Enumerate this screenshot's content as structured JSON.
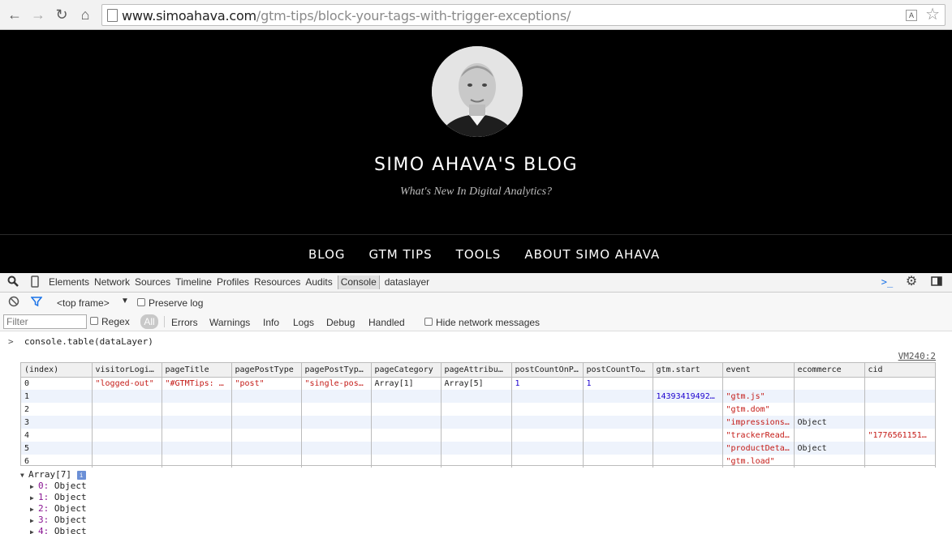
{
  "browser": {
    "url_host": "www.simoahava.com",
    "url_path": "/gtm-tips/block-your-tags-with-trigger-exceptions/"
  },
  "site": {
    "title": "SIMO AHAVA'S BLOG",
    "tagline": "What's New In Digital Analytics?",
    "nav": [
      "BLOG",
      "GTM TIPS",
      "TOOLS",
      "ABOUT SIMO AHAVA"
    ]
  },
  "devtools": {
    "tabs": [
      "Elements",
      "Network",
      "Sources",
      "Timeline",
      "Profiles",
      "Resources",
      "Audits",
      "Console",
      "dataslayer"
    ],
    "active_tab": "Console",
    "frame_select": "<top frame>",
    "preserve_log": "Preserve log",
    "filter_placeholder": "Filter",
    "regex_label": "Regex",
    "levels": [
      "All",
      "Errors",
      "Warnings",
      "Info",
      "Logs",
      "Debug",
      "Handled"
    ],
    "hide_network": "Hide network messages",
    "command": "console.table(dataLayer)",
    "source_link": "VM240:2",
    "table": {
      "headers": [
        "(index)",
        "visitorLogi…",
        "pageTitle",
        "pagePostType",
        "pagePostTyp…",
        "pageCategory",
        "pageAttribu…",
        "postCountOnP…",
        "postCountTo…",
        "gtm.start",
        "event",
        "ecommerce",
        "cid"
      ],
      "rows": [
        [
          "0",
          "\"logged-out\"",
          "\"#GTMTips: …",
          "\"post\"",
          "\"single-pos…",
          "Array[1]",
          "Array[5]",
          "1",
          "1",
          "",
          "",
          "",
          ""
        ],
        [
          "1",
          "",
          "",
          "",
          "",
          "",
          "",
          "",
          "",
          "14393419492…",
          "\"gtm.js\"",
          "",
          ""
        ],
        [
          "2",
          "",
          "",
          "",
          "",
          "",
          "",
          "",
          "",
          "",
          "\"gtm.dom\"",
          "",
          ""
        ],
        [
          "3",
          "",
          "",
          "",
          "",
          "",
          "",
          "",
          "",
          "",
          "\"impressions…",
          "Object",
          ""
        ],
        [
          "4",
          "",
          "",
          "",
          "",
          "",
          "",
          "",
          "",
          "",
          "\"trackerRead…",
          "",
          "\"1776561151…"
        ],
        [
          "5",
          "",
          "",
          "",
          "",
          "",
          "",
          "",
          "",
          "",
          "\"productDeta…",
          "Object",
          ""
        ],
        [
          "6",
          "",
          "",
          "",
          "",
          "",
          "",
          "",
          "",
          "",
          "\"gtm.load\"",
          "",
          ""
        ]
      ]
    },
    "tree": {
      "root": "Array[7]",
      "items": [
        {
          "key": "0",
          "value": "Object"
        },
        {
          "key": "1",
          "value": "Object"
        },
        {
          "key": "2",
          "value": "Object"
        },
        {
          "key": "3",
          "value": "Object"
        },
        {
          "key": "4",
          "value": "Object"
        }
      ]
    }
  }
}
